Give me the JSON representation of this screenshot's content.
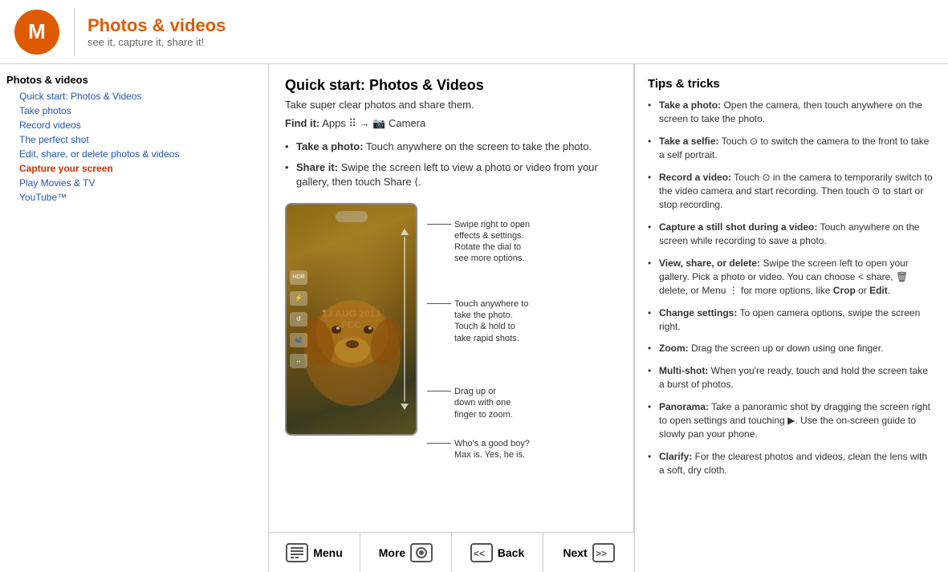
{
  "header": {
    "title": "Photos & videos",
    "subtitle": "see it, capture it, share it!"
  },
  "sidebar": {
    "title": "Photos & videos",
    "items": [
      {
        "label": "Quick start: Photos & Videos",
        "indent": true,
        "active": false
      },
      {
        "label": "Take photos",
        "indent": true,
        "active": false
      },
      {
        "label": "Record videos",
        "indent": true,
        "active": false
      },
      {
        "label": "The perfect shot",
        "indent": true,
        "active": false
      },
      {
        "label": "Edit, share, or delete photos & videos",
        "indent": true,
        "active": false
      },
      {
        "label": "Capture your screen",
        "indent": true,
        "active": true
      },
      {
        "label": "Play Movies & TV",
        "indent": true,
        "active": false
      },
      {
        "label": "YouTube™",
        "indent": true,
        "active": false
      }
    ]
  },
  "bottom_bar": {
    "menu_label": "Menu",
    "more_label": "More",
    "back_label": "Back",
    "next_label": "Next"
  },
  "center": {
    "title": "Quick start: Photos & Videos",
    "subtitle": "Take super clear photos and share them.",
    "find_it_prefix": "Find it:",
    "find_it_apps": "Apps",
    "find_it_arrow": "→",
    "find_it_camera": "Camera",
    "bullets": [
      {
        "bold": "Take a photo:",
        "text": " Touch anywhere on the screen to take the photo."
      },
      {
        "bold": "Share it:",
        "text": " Swipe the screen left to view a photo or video from your gallery, then touch Share"
      }
    ],
    "date_overlay": "13 AUG 2013",
    "date_overlay2": "FCC",
    "annotations": [
      {
        "text": "Swipe right to open effects & settings. Rotate the dial to see more options."
      },
      {
        "text": "Touch anywhere to take the photo. Touch & hold to take rapid shots."
      },
      {
        "text": "Drag up or down with one finger to zoom."
      },
      {
        "text": "Who's a good boy? Max is. Yes, he is."
      }
    ]
  },
  "tips": {
    "title": "Tips & tricks",
    "items": [
      {
        "bold": "Take a photo:",
        "text": " Open the camera, then touch anywhere on the screen to take the photo."
      },
      {
        "bold": "Take a selfie:",
        "text": " Touch  to switch the camera to the front to take a self portrait."
      },
      {
        "bold": "Record a video:",
        "text": " Touch  in the camera to temporarily switch to the video camera and start recording. Then touch  to start or stop recording."
      },
      {
        "bold": "Capture a still shot during a video:",
        "text": " Touch anywhere on the screen while recording to save a photo."
      },
      {
        "bold": "View, share, or delete:",
        "text": " Swipe the screen left to open your gallery. Pick a photo or video. You can choose  share,  delete, or Menu  for more options, like Crop or Edit."
      },
      {
        "bold": "Change settings:",
        "text": " To open camera options, swipe the screen right."
      },
      {
        "bold": "Zoom:",
        "text": " Drag the screen up or down using one finger."
      },
      {
        "bold": "Multi-shot:",
        "text": " When you're ready, touch and hold the screen take a burst of photos."
      },
      {
        "bold": "Panorama:",
        "text": " Take a panoramic shot by dragging the screen right to open settings and touching . Use the on-screen guide to slowly pan your phone."
      },
      {
        "bold": "Clarify:",
        "text": " For the clearest photos and videos, clean the lens with a soft, dry cloth."
      }
    ]
  }
}
